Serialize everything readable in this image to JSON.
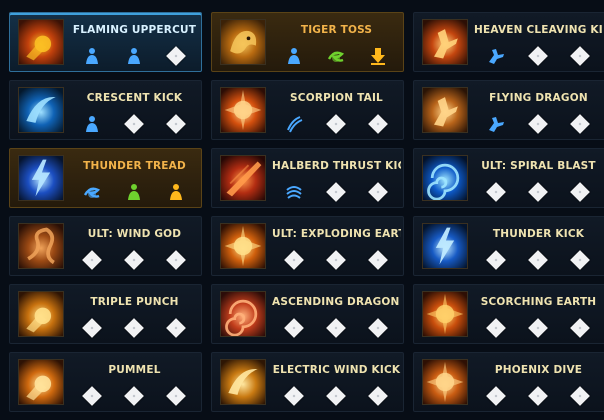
{
  "skills": [
    {
      "name": "FLAMING UPPERCUT",
      "state": "selected",
      "icon": "flaming-uppercut-icon",
      "runes": [
        "blue-figure-rune",
        "blue-figure-rune",
        "empty"
      ]
    },
    {
      "name": "TIGER TOSS",
      "state": "highlighted",
      "icon": "tiger-toss-icon",
      "runes": [
        "blue-figure-rune",
        "green-swirl-rune",
        "gold-arrow-rune"
      ]
    },
    {
      "name": "HEAVEN CLEAVING KICK",
      "state": "normal",
      "icon": "heaven-cleaving-kick-icon",
      "runes": [
        "blue-kick-rune",
        "empty",
        "empty"
      ]
    },
    {
      "name": "CRESCENT KICK",
      "state": "normal",
      "icon": "crescent-kick-icon",
      "runes": [
        "blue-figure-rune",
        "empty",
        "empty"
      ]
    },
    {
      "name": "SCORPION TAIL",
      "state": "normal",
      "icon": "scorpion-tail-icon",
      "runes": [
        "blue-claw-rune",
        "empty",
        "empty"
      ]
    },
    {
      "name": "FLYING DRAGON",
      "state": "normal",
      "icon": "flying-dragon-icon",
      "runes": [
        "blue-kick-rune",
        "empty",
        "empty"
      ]
    },
    {
      "name": "THUNDER TREAD",
      "state": "highlighted",
      "icon": "thunder-tread-icon",
      "runes": [
        "blue-swirl-rune",
        "green-figure-rune",
        "gold-figure-rune"
      ]
    },
    {
      "name": "HALBERD THRUST KICK",
      "state": "normal",
      "icon": "halberd-thrust-kick-icon",
      "runes": [
        "blue-wind-rune",
        "empty",
        "empty"
      ]
    },
    {
      "name": "ULT: SPIRAL BLAST",
      "state": "normal",
      "icon": "spiral-blast-icon",
      "runes": [
        "empty",
        "empty",
        "empty"
      ]
    },
    {
      "name": "ULT: WIND GOD",
      "state": "normal",
      "icon": "wind-god-icon",
      "runes": [
        "empty",
        "empty",
        "empty"
      ]
    },
    {
      "name": "ULT: EXPLODING EART...",
      "state": "normal",
      "icon": "exploding-earth-icon",
      "runes": [
        "empty",
        "empty",
        "empty"
      ]
    },
    {
      "name": "THUNDER KICK",
      "state": "normal",
      "icon": "thunder-kick-icon",
      "runes": [
        "empty",
        "empty",
        "empty"
      ]
    },
    {
      "name": "TRIPLE PUNCH",
      "state": "normal",
      "icon": "triple-punch-icon",
      "runes": [
        "empty",
        "empty",
        "empty"
      ]
    },
    {
      "name": "ASCENDING DRAGON ...",
      "state": "normal",
      "icon": "ascending-dragon-icon",
      "runes": [
        "empty",
        "empty",
        "empty"
      ]
    },
    {
      "name": "SCORCHING EARTH",
      "state": "normal",
      "icon": "scorching-earth-icon",
      "runes": [
        "empty",
        "empty",
        "empty"
      ]
    },
    {
      "name": "PUMMEL",
      "state": "normal",
      "icon": "pummel-icon",
      "runes": [
        "empty",
        "empty",
        "empty"
      ]
    },
    {
      "name": "ELECTRIC WIND KICK",
      "state": "normal",
      "icon": "electric-wind-kick-icon",
      "runes": [
        "empty",
        "empty",
        "empty"
      ]
    },
    {
      "name": "PHOENIX DIVE",
      "state": "normal",
      "icon": "phoenix-dive-icon",
      "runes": [
        "empty",
        "empty",
        "empty"
      ]
    }
  ],
  "colors": {
    "selected_border": "#3fa0dc",
    "highlight_text": "#f2b34a",
    "normal_text": "#efe3b0",
    "rune_blue": "#4aa8ff",
    "rune_green": "#6fd12e",
    "rune_gold": "#ffb81c"
  }
}
